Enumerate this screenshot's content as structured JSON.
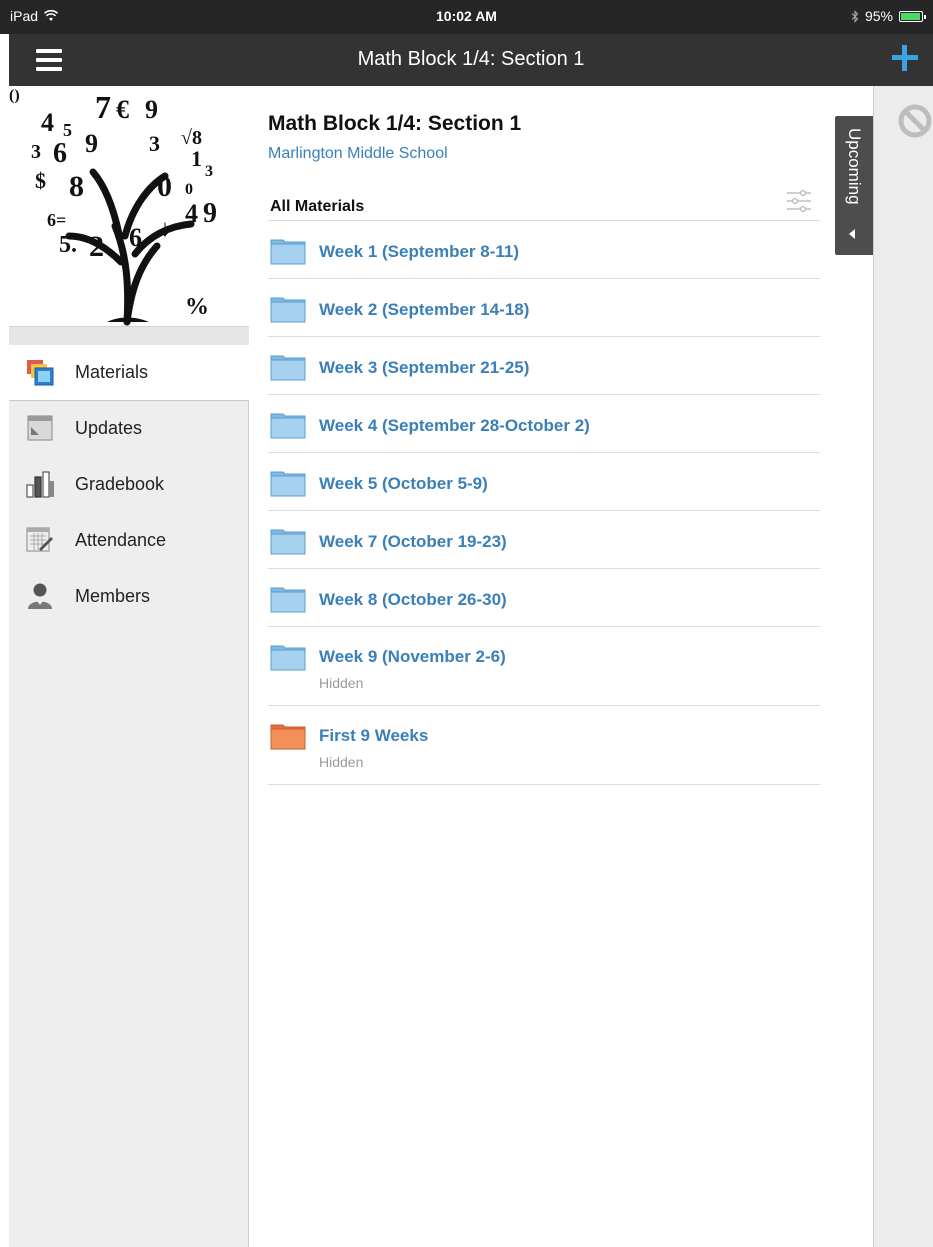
{
  "status_bar": {
    "device": "iPad",
    "time": "10:02 AM",
    "battery": "95%",
    "battery_level": 0.95
  },
  "nav": {
    "title": "Math Block 1/4: Section 1",
    "menu_icon": "hamburger-menu-icon",
    "add_icon": "plus-icon",
    "accent_color": "#3aa3e3"
  },
  "sidebar": {
    "items": [
      {
        "label": "Materials",
        "icon": "materials-icon",
        "active": true
      },
      {
        "label": "Updates",
        "icon": "updates-icon",
        "active": false
      },
      {
        "label": "Gradebook",
        "icon": "gradebook-icon",
        "active": false
      },
      {
        "label": "Attendance",
        "icon": "attendance-icon",
        "active": false
      },
      {
        "label": "Members",
        "icon": "members-icon",
        "active": false
      }
    ]
  },
  "main": {
    "course_title": "Math Block 1/4: Section 1",
    "school": "Marlington Middle School",
    "section_label": "All Materials",
    "folders": [
      {
        "name": "Week 1 (September 8-11)",
        "status": "",
        "color": "blue"
      },
      {
        "name": "Week 2 (September 14-18)",
        "status": "",
        "color": "blue"
      },
      {
        "name": "Week 3 (September 21-25)",
        "status": "",
        "color": "blue"
      },
      {
        "name": "Week 4 (September 28-October 2)",
        "status": "",
        "color": "blue"
      },
      {
        "name": "Week 5 (October 5-9)",
        "status": "",
        "color": "blue"
      },
      {
        "name": "Week 7 (October 19-23)",
        "status": "",
        "color": "blue"
      },
      {
        "name": "Week 8 (October 26-30)",
        "status": "",
        "color": "blue"
      },
      {
        "name": "Week 9 (November 2-6)",
        "status": "Hidden",
        "color": "blue"
      },
      {
        "name": "First 9 Weeks",
        "status": "Hidden",
        "color": "orange"
      }
    ]
  },
  "upcoming": {
    "label": "Upcoming"
  },
  "colors": {
    "link": "#3b7fb8",
    "folder_blue": "#8ec3e8",
    "folder_orange": "#f0884f"
  }
}
